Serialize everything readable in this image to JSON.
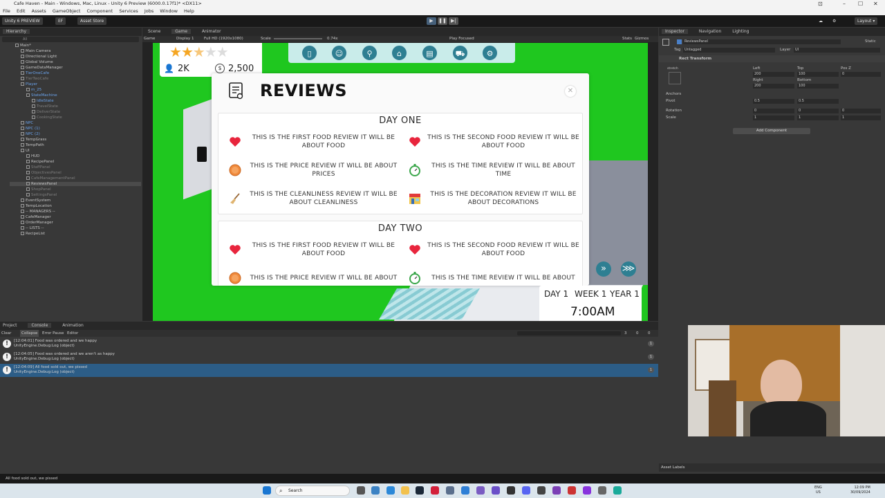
{
  "window": {
    "title": "Cafe Haven - Main - Windows, Mac, Linux - Unity 6 Preview (6000.0.17f1)* <DX11>"
  },
  "menu": [
    "File",
    "Edit",
    "Assets",
    "GameObject",
    "Component",
    "Services",
    "Jobs",
    "Window",
    "Help"
  ],
  "toolbar": {
    "account": "Unity 6 PREVIEW",
    "ef": "EF",
    "asset_store": "Asset Store",
    "layout": "Layout"
  },
  "hierarchy": {
    "tab": "Hierarchy",
    "search_placeholder": "All",
    "items": [
      {
        "label": "Main*",
        "indent": 0,
        "style": "normal"
      },
      {
        "label": "Main Camera",
        "indent": 1,
        "style": "normal"
      },
      {
        "label": "Directional Light",
        "indent": 1,
        "style": "normal"
      },
      {
        "label": "Global Volume",
        "indent": 1,
        "style": "normal"
      },
      {
        "label": "GameDataManager",
        "indent": 1,
        "style": "normal"
      },
      {
        "label": "TierOneCafe",
        "indent": 1,
        "style": "blue"
      },
      {
        "label": "TierTwoCafe",
        "indent": 1,
        "style": "grey"
      },
      {
        "label": "Player",
        "indent": 1,
        "style": "blue"
      },
      {
        "label": "m_25",
        "indent": 2,
        "style": "blue"
      },
      {
        "label": "StateMachine",
        "indent": 2,
        "style": "blue"
      },
      {
        "label": "IdleState",
        "indent": 3,
        "style": "blue"
      },
      {
        "label": "TravelState",
        "indent": 3,
        "style": "grey"
      },
      {
        "label": "DeliverState",
        "indent": 3,
        "style": "grey"
      },
      {
        "label": "CookingState",
        "indent": 3,
        "style": "grey"
      },
      {
        "label": "NPC",
        "indent": 1,
        "style": "blue"
      },
      {
        "label": "NPC (1)",
        "indent": 1,
        "style": "blue"
      },
      {
        "label": "NPC (2)",
        "indent": 1,
        "style": "blue"
      },
      {
        "label": "TempGrass",
        "indent": 1,
        "style": "normal"
      },
      {
        "label": "TempPath",
        "indent": 1,
        "style": "normal"
      },
      {
        "label": "UI",
        "indent": 1,
        "style": "normal"
      },
      {
        "label": "HUD",
        "indent": 2,
        "style": "normal"
      },
      {
        "label": "RecipePanel",
        "indent": 2,
        "style": "normal"
      },
      {
        "label": "StaffPanel",
        "indent": 2,
        "style": "grey"
      },
      {
        "label": "ObjectivesPanel",
        "indent": 2,
        "style": "grey"
      },
      {
        "label": "CafeManagementPanel",
        "indent": 2,
        "style": "grey"
      },
      {
        "label": "ReviewsPanel",
        "indent": 2,
        "style": "selected"
      },
      {
        "label": "ShopPanel",
        "indent": 2,
        "style": "grey"
      },
      {
        "label": "SettingsPanel",
        "indent": 2,
        "style": "grey"
      },
      {
        "label": "EventSystem",
        "indent": 1,
        "style": "normal"
      },
      {
        "label": "TempLocation",
        "indent": 1,
        "style": "normal"
      },
      {
        "label": "-- MANAGERS --",
        "indent": 1,
        "style": "normal"
      },
      {
        "label": "CafeManager",
        "indent": 1,
        "style": "normal"
      },
      {
        "label": "OrderManager",
        "indent": 1,
        "style": "normal"
      },
      {
        "label": "-- LISTS --",
        "indent": 1,
        "style": "normal"
      },
      {
        "label": "RecipeList",
        "indent": 1,
        "style": "normal"
      }
    ]
  },
  "scene_tabs": [
    "Scene",
    "Game",
    "Animator"
  ],
  "game_toolbar": {
    "mode": "Game",
    "display": "Display 1",
    "resolution": "Full HD (1920x1080)",
    "scale_label": "Scale",
    "scale_value": "0.74x",
    "play_focused": "Play Focused",
    "stats": "Stats",
    "gizmos": "Gizmos"
  },
  "game_hud": {
    "stars": 2.5,
    "followers": "2K",
    "money": "2,500",
    "nav_icons": [
      "book-icon",
      "chef-icon",
      "whisk-icon",
      "house-icon",
      "fridge-icon",
      "cart-icon",
      "settings-icon"
    ],
    "day_label": "DAY 1",
    "week_label": "WEEK 1",
    "year_label": "YEAR 1",
    "time": "7:00AM"
  },
  "reviews_panel": {
    "title": "REVIEWS",
    "days": [
      {
        "title": "DAY ONE",
        "reviews": [
          {
            "icon": "heart-icon",
            "text": "THIS IS THE FIRST FOOD REVIEW IT WILL BE ABOUT FOOD"
          },
          {
            "icon": "heart-icon",
            "text": "THIS IS THE SECOND FOOD REVIEW IT WILL BE ABOUT FOOD"
          },
          {
            "icon": "coin-icon",
            "text": "THIS IS THE PRICE REVIEW IT WILL BE ABOUT PRICES"
          },
          {
            "icon": "stopwatch-icon",
            "text": "THIS IS THE TIME REVIEW IT WILL BE ABOUT TIME"
          },
          {
            "icon": "broom-icon",
            "text": "THIS IS THE CLEANLINESS REVIEW IT WILL BE ABOUT CLEANLINESS"
          },
          {
            "icon": "storefront-icon",
            "text": "THIS IS THE DECORATION REVIEW IT WILL BE ABOUT DECORATIONS"
          }
        ]
      },
      {
        "title": "DAY TWO",
        "reviews": [
          {
            "icon": "heart-icon",
            "text": "THIS IS THE FIRST FOOD REVIEW IT WILL BE ABOUT FOOD"
          },
          {
            "icon": "heart-icon",
            "text": "THIS IS THE SECOND FOOD REVIEW IT WILL BE ABOUT FOOD"
          },
          {
            "icon": "coin-icon",
            "text": "THIS IS THE PRICE REVIEW IT WILL BE ABOUT"
          },
          {
            "icon": "stopwatch-icon",
            "text": "THIS IS THE TIME REVIEW IT WILL BE ABOUT"
          }
        ]
      }
    ]
  },
  "inspector": {
    "tabs": [
      "Inspector",
      "Navigation",
      "Lighting"
    ],
    "object_name": "ReviewsPanel",
    "static": "Static",
    "tag_label": "Tag",
    "tag_value": "Untagged",
    "layer_label": "Layer",
    "layer_value": "UI",
    "component": "Rect Transform",
    "stretch": "stretch",
    "left_label": "Left",
    "left_value": "200",
    "top_label": "Top",
    "top_value": "100",
    "posz_label": "Pos Z",
    "posz_value": "0",
    "right_label": "Right",
    "right_value": "200",
    "bottom_label": "Bottom",
    "bottom_value": "100",
    "anchors": "Anchors",
    "pivot": "Pivot",
    "pivot_x": "0.5",
    "pivot_y": "0.5",
    "rotation": "Rotation",
    "rot_x": "0",
    "rot_y": "0",
    "rot_z": "0",
    "scale": "Scale",
    "scale_x": "1",
    "scale_y": "1",
    "scale_z": "1",
    "add_component": "Add Component",
    "asset_labels": "Asset Labels"
  },
  "console": {
    "tabs": [
      "Project",
      "Console",
      "Animation"
    ],
    "buttons": [
      "Clear",
      "Collapse",
      "Error Pause",
      "Editor"
    ],
    "counts": {
      "info": "3",
      "warn": "0",
      "error": "0"
    },
    "logs": [
      {
        "line1": "[12:04:01] Food was ordered and we happy",
        "line2": "UnityEngine.Debug:Log (object)",
        "count": "1",
        "selected": false
      },
      {
        "line1": "[12:04:05] Food was ordered and we aren't as happy",
        "line2": "UnityEngine.Debug:Log (object)",
        "count": "1",
        "selected": false
      },
      {
        "line1": "[12:04:09] All food sold out, we pissed",
        "line2": "UnityEngine.Debug:Log (object)",
        "count": "1",
        "selected": true
      }
    ]
  },
  "status_bar": "All food sold out, we pissed",
  "taskbar": {
    "search": "Search",
    "lang": "ENG",
    "region": "US",
    "time": "12:09 PM",
    "date": "30/09/2024"
  },
  "colors": {
    "game_green": "#1fc71f",
    "heart": "#e8253d",
    "accent_teal": "#2e7f92",
    "selection_blue": "#2c5d87"
  }
}
